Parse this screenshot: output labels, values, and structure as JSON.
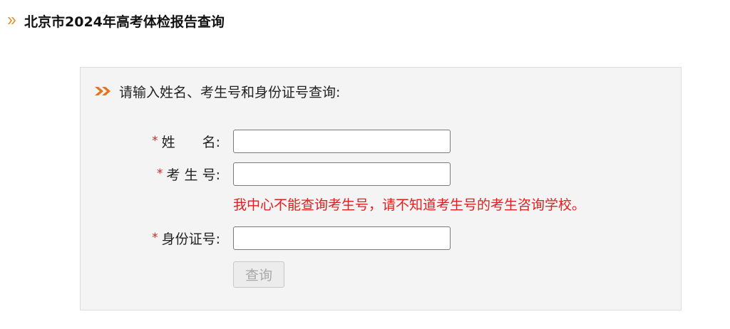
{
  "header": {
    "title": "北京市2024年高考体检报告查询",
    "icon": "double-chevron-right-icon",
    "icon_color": "#e08a1e"
  },
  "panel": {
    "icon": "double-chevron-right-icon",
    "icon_color": "#e8711c",
    "instruction": "请输入姓名、考生号和身份证号查询:",
    "fields": {
      "name": {
        "required_mark": "*",
        "label": "姓　　名:",
        "value": "",
        "placeholder": ""
      },
      "exam_number": {
        "required_mark": "*",
        "label": "考 生 号:",
        "value": "",
        "placeholder": ""
      },
      "id_number": {
        "required_mark": "*",
        "label": "身份证号:",
        "value": "",
        "placeholder": ""
      }
    },
    "hint": "我中心不能查询考生号，请不知道考生号的考生咨询学校。",
    "hint_color": "#e02020",
    "submit_label": "查询"
  }
}
